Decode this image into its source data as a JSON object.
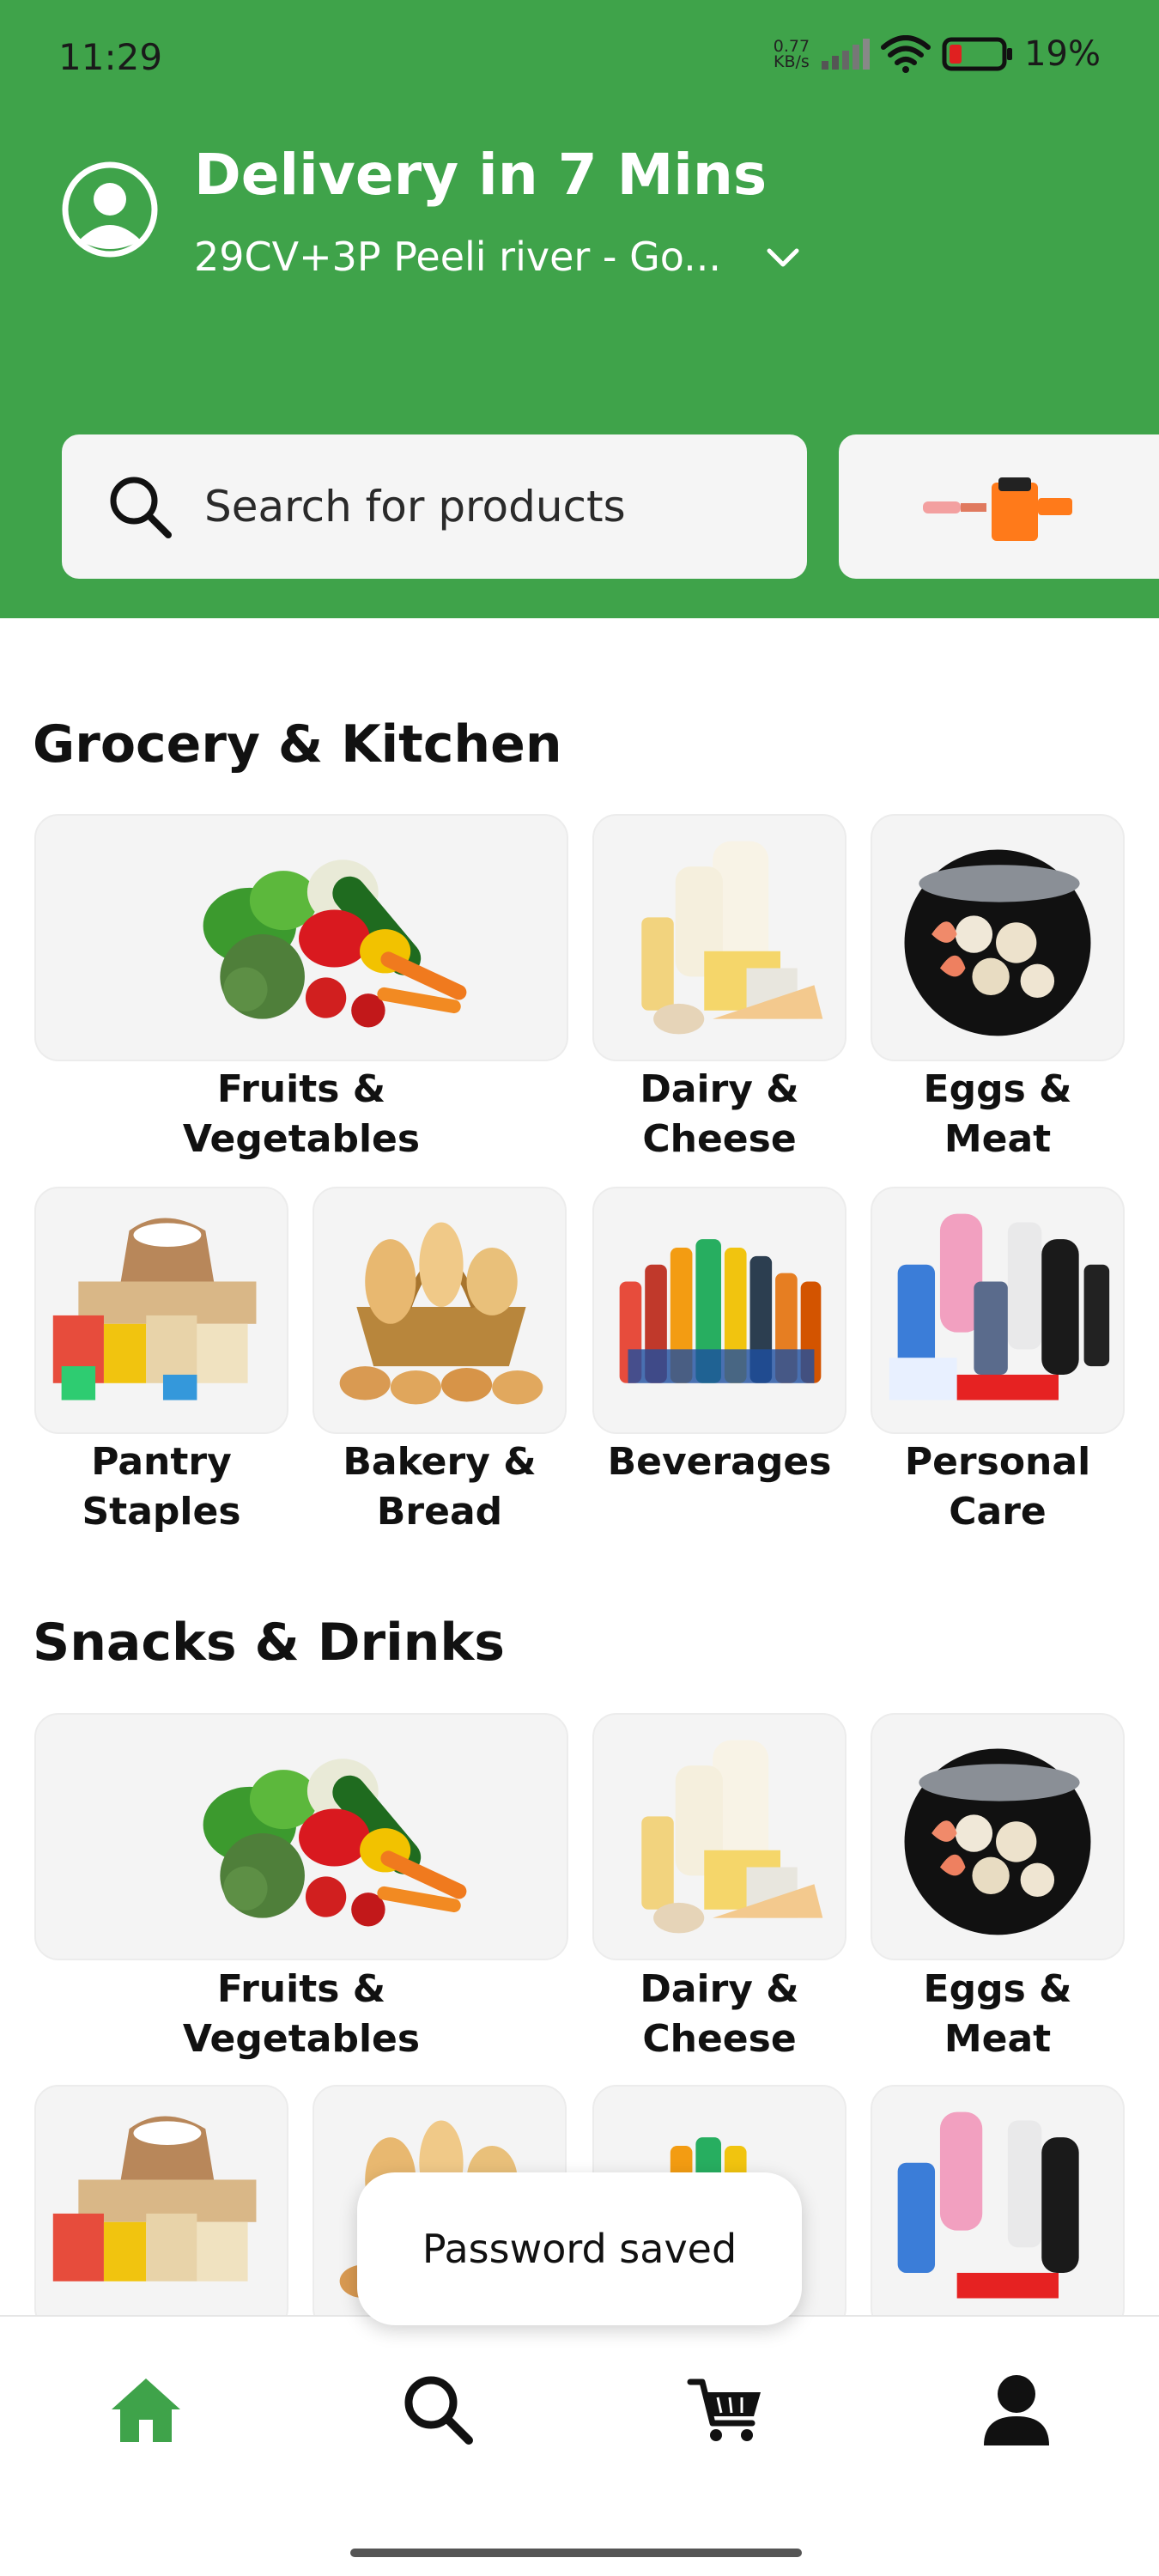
{
  "status_bar": {
    "time": "11:29",
    "net_speed_value": "0.77",
    "net_speed_unit": "KB/s",
    "battery_percent": "19%"
  },
  "header": {
    "delivery_title": "Delivery in 7 Mins",
    "address": "29CV+3P Peeli river - Go...",
    "background_color": "#3fa34a"
  },
  "search": {
    "placeholder": "Search for products"
  },
  "sections": [
    {
      "title": "Grocery & Kitchen",
      "categories": [
        {
          "line1": "Fruits &",
          "line2": "Vegetables",
          "icon": "vegetables-image"
        },
        {
          "line1": "Dairy &",
          "line2": "Cheese",
          "icon": "dairy-image"
        },
        {
          "line1": "Eggs &",
          "line2": "Meat",
          "icon": "seafood-image"
        },
        {
          "line1": "Pantry",
          "line2": "Staples",
          "icon": "pantry-image"
        },
        {
          "line1": "Bakery &",
          "line2": "Bread",
          "icon": "bakery-image"
        },
        {
          "line1": "Beverages",
          "line2": "",
          "icon": "beverages-image"
        },
        {
          "line1": "Personal",
          "line2": "Care",
          "icon": "personal-care-image"
        }
      ]
    },
    {
      "title": "Snacks & Drinks",
      "categories": [
        {
          "line1": "Fruits &",
          "line2": "Vegetables",
          "icon": "vegetables-image"
        },
        {
          "line1": "Dairy &",
          "line2": "Cheese",
          "icon": "dairy-image"
        },
        {
          "line1": "Eggs &",
          "line2": "Meat",
          "icon": "seafood-image"
        }
      ]
    }
  ],
  "toast": {
    "message": "Password saved"
  },
  "bottom_nav": [
    {
      "icon": "home-icon",
      "active": true,
      "active_color": "#3fa34a"
    },
    {
      "icon": "search-icon"
    },
    {
      "icon": "cart-icon"
    },
    {
      "icon": "profile-icon"
    }
  ]
}
